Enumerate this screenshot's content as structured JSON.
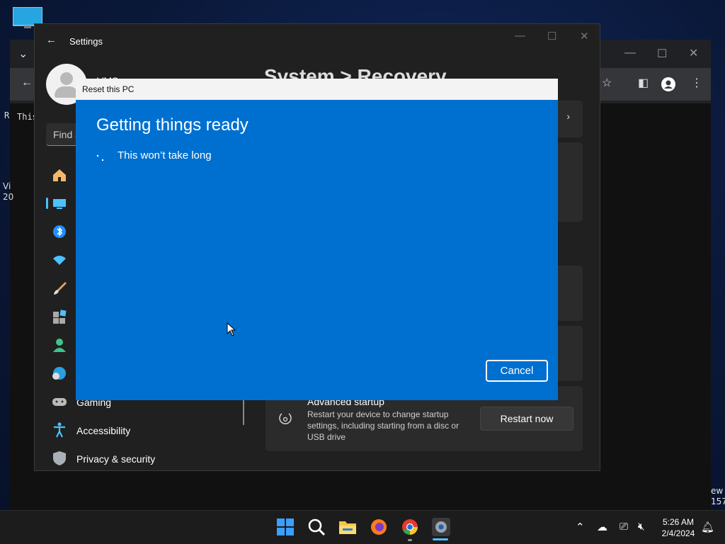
{
  "browser": {
    "terminal_line": "R",
    "terminal_line2": "This",
    "desk_text_a": "Vi",
    "desk_text_b": "20",
    "desk_text_c": "ew",
    "desk_text_d": "157"
  },
  "settings": {
    "window_title": "Settings",
    "user_name": "VMS",
    "breadcrumb": "System  >  Recovery",
    "search_placeholder": "Find a",
    "nav": {
      "gaming": "Gaming",
      "accessibility": "Accessibility",
      "privacy": "Privacy & security"
    },
    "advanced_startup": {
      "title": "Advanced startup",
      "description": "Restart your device to change startup settings, including starting from a disc or USB drive",
      "button": "Restart now"
    }
  },
  "dialog": {
    "title": "Reset this PC",
    "heading": "Getting things ready",
    "subtext": "This won’t take long",
    "cancel_label": "Cancel"
  },
  "taskbar": {
    "time": "5:26 AM",
    "date": "2/4/2024"
  },
  "colors": {
    "dialog_blue": "#0070d0",
    "accent": "#4cc2ff",
    "settings_bg": "#202020"
  }
}
